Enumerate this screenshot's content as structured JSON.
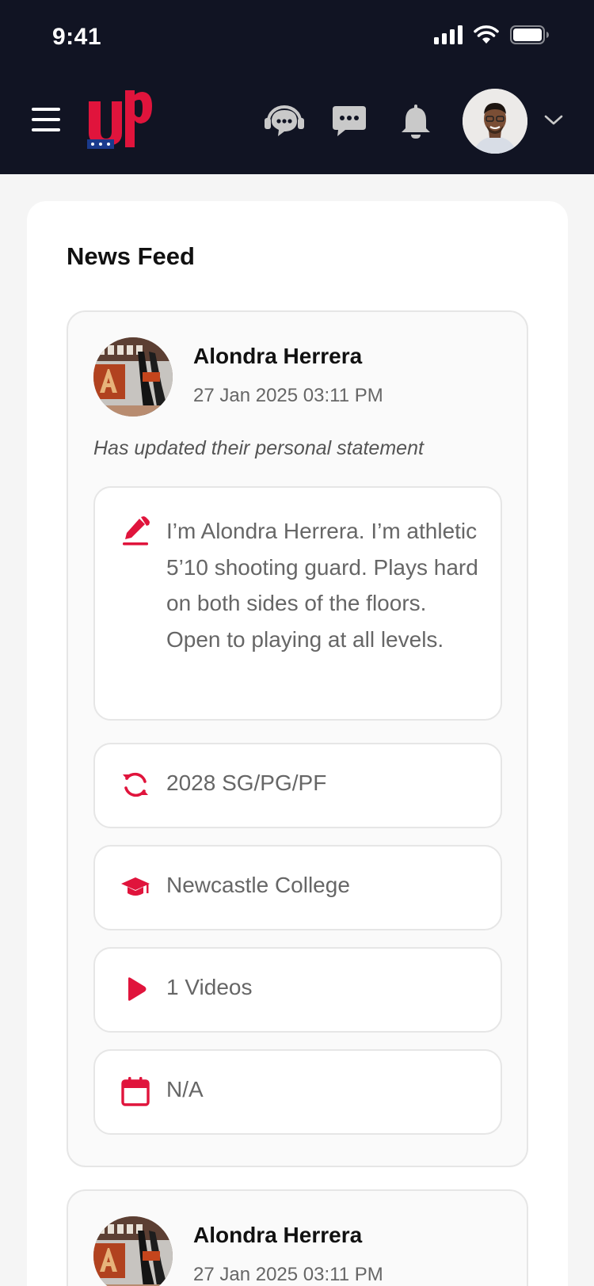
{
  "status_bar": {
    "time": "9:41"
  },
  "header": {
    "menu_icon": "hamburger-menu-icon",
    "logo_text": "UP",
    "icons": [
      "support-headset-icon",
      "chat-bubble-icon",
      "bell-icon"
    ],
    "avatar": "user-avatar",
    "dropdown_icon": "chevron-down-icon"
  },
  "colors": {
    "accent": "#e0143c",
    "topbar": "#111423",
    "logo_blue": "#1a3a8c"
  },
  "feed": {
    "title": "News Feed",
    "posts": [
      {
        "author": "Alondra Herrera",
        "date": "27 Jan 2025 03:11 PM",
        "activity": "Has updated their personal statement",
        "statement": "I’m Alondra Herrera. I’m athletic 5’10 shooting guard. Plays hard on both sides of the floors. Open to playing at all levels.",
        "position": "2028 SG/PG/PF",
        "school": "Newcastle College",
        "videos": "1 Videos",
        "date_info": "N/A"
      },
      {
        "author": "Alondra Herrera",
        "date": "27 Jan 2025 03:11 PM"
      }
    ]
  }
}
